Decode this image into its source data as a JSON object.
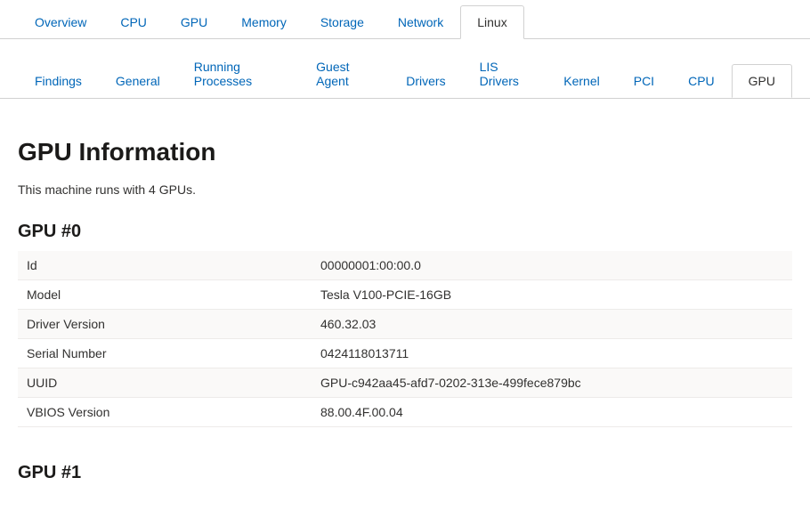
{
  "primaryTabs": {
    "items": [
      {
        "label": "Overview",
        "name": "tab-overview",
        "active": false
      },
      {
        "label": "CPU",
        "name": "tab-cpu",
        "active": false
      },
      {
        "label": "GPU",
        "name": "tab-gpu",
        "active": false
      },
      {
        "label": "Memory",
        "name": "tab-memory",
        "active": false
      },
      {
        "label": "Storage",
        "name": "tab-storage",
        "active": false
      },
      {
        "label": "Network",
        "name": "tab-network",
        "active": false
      },
      {
        "label": "Linux",
        "name": "tab-linux",
        "active": true
      }
    ]
  },
  "secondaryTabs": {
    "items": [
      {
        "label": "Findings",
        "name": "subtab-findings",
        "active": false
      },
      {
        "label": "General",
        "name": "subtab-general",
        "active": false
      },
      {
        "label": "Running Processes",
        "name": "subtab-running-processes",
        "active": false
      },
      {
        "label": "Guest Agent",
        "name": "subtab-guest-agent",
        "active": false
      },
      {
        "label": "Drivers",
        "name": "subtab-drivers",
        "active": false
      },
      {
        "label": "LIS Drivers",
        "name": "subtab-lis-drivers",
        "active": false
      },
      {
        "label": "Kernel",
        "name": "subtab-kernel",
        "active": false
      },
      {
        "label": "PCI",
        "name": "subtab-pci",
        "active": false
      },
      {
        "label": "CPU",
        "name": "subtab-cpu",
        "active": false
      },
      {
        "label": "GPU",
        "name": "subtab-gpu",
        "active": true
      }
    ]
  },
  "page": {
    "title": "GPU Information",
    "description": "This machine runs with 4 GPUs."
  },
  "gpuSections": [
    {
      "heading": "GPU #0",
      "rows": [
        {
          "label": "Id",
          "value": "00000001:00:00.0"
        },
        {
          "label": "Model",
          "value": "Tesla V100-PCIE-16GB"
        },
        {
          "label": "Driver Version",
          "value": "460.32.03"
        },
        {
          "label": "Serial Number",
          "value": "0424118013711"
        },
        {
          "label": "UUID",
          "value": "GPU-c942aa45-afd7-0202-313e-499fece879bc"
        },
        {
          "label": "VBIOS Version",
          "value": "88.00.4F.00.04"
        }
      ]
    },
    {
      "heading": "GPU #1",
      "rows": []
    }
  ]
}
